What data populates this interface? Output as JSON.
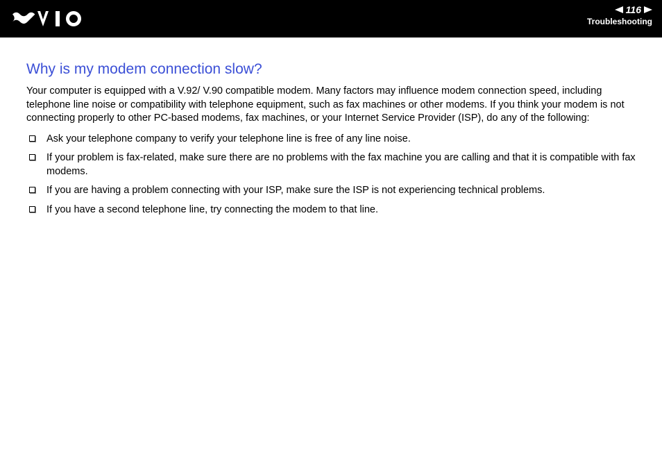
{
  "header": {
    "page_number": "116",
    "section": "Troubleshooting"
  },
  "content": {
    "title": "Why is my modem connection slow?",
    "intro": "Your computer is equipped with a V.92/ V.90 compatible modem. Many factors may influence modem connection speed, including telephone line noise or compatibility with telephone equipment, such as fax machines or other modems. If you think your modem is not connecting properly to other PC-based modems, fax machines, or your Internet Service Provider (ISP), do any of the following:",
    "bullets": [
      "Ask your telephone company to verify your telephone line is free of any line noise.",
      "If your problem is fax-related, make sure there are no problems with the fax machine you are calling and that it is compatible with fax modems.",
      "If you are having a problem connecting with your ISP, make sure the ISP is not experiencing technical problems.",
      "If you have a second telephone line, try connecting the modem to that line."
    ]
  }
}
